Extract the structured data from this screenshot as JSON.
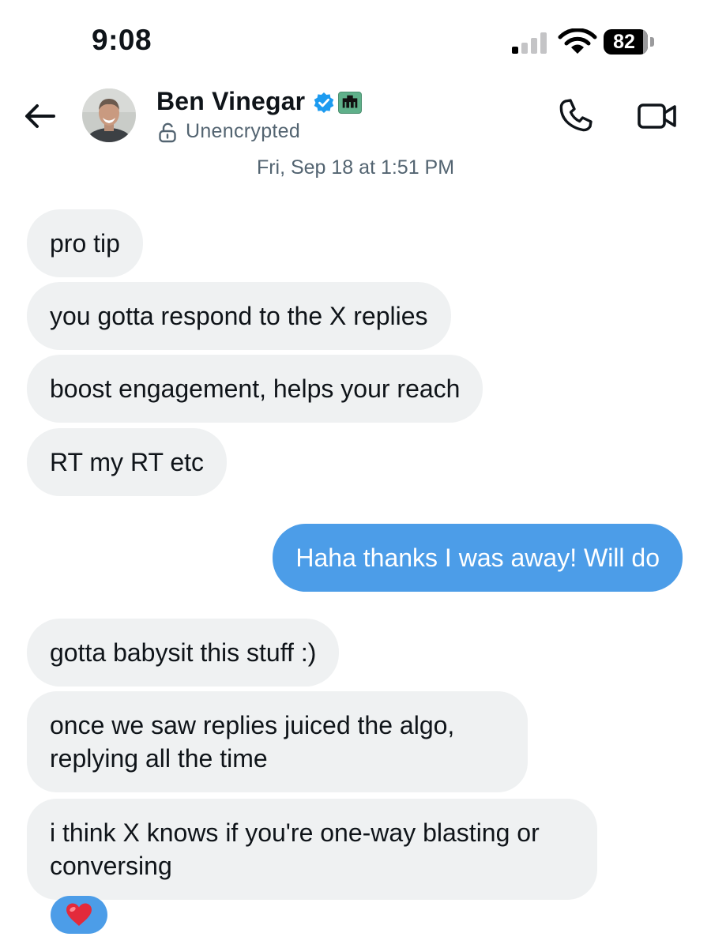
{
  "status_bar": {
    "time": "9:08",
    "battery": "82",
    "signal_bars_active": 1,
    "signal_bars_total": 4
  },
  "header": {
    "contact_name": "Ben Vinegar",
    "encryption_status": "Unencrypted",
    "verified_badge": "verified-badge-icon",
    "affiliate_badge": "affiliate-badge-icon",
    "actions": [
      "phone-icon",
      "video-camera-icon"
    ]
  },
  "conversation": {
    "timestamp": "Fri, Sep 18 at 1:51 PM",
    "messages": [
      {
        "direction": "incoming",
        "text": "pro tip"
      },
      {
        "direction": "incoming",
        "text": "you gotta respond to the X replies"
      },
      {
        "direction": "incoming",
        "text": "boost engagement, helps your reach"
      },
      {
        "direction": "incoming",
        "text": "RT my RT etc"
      },
      {
        "direction": "outgoing",
        "text": "Haha thanks I was away! Will do"
      },
      {
        "direction": "incoming",
        "text": "gotta babysit this stuff :)"
      },
      {
        "direction": "incoming",
        "text": "once we saw replies juiced the algo, replying all the time"
      },
      {
        "direction": "incoming",
        "text": "i think X knows if you're one-way blasting or conversing"
      }
    ],
    "reaction": {
      "emoji": "❤️",
      "icon": "red-heart-icon"
    }
  },
  "colors": {
    "incoming_bubble": "#eff1f2",
    "outgoing_bubble": "#4c9de8",
    "secondary_text": "#536471",
    "verified_blue": "#1d9bf0",
    "affiliate_badge": "#5fb08a"
  }
}
